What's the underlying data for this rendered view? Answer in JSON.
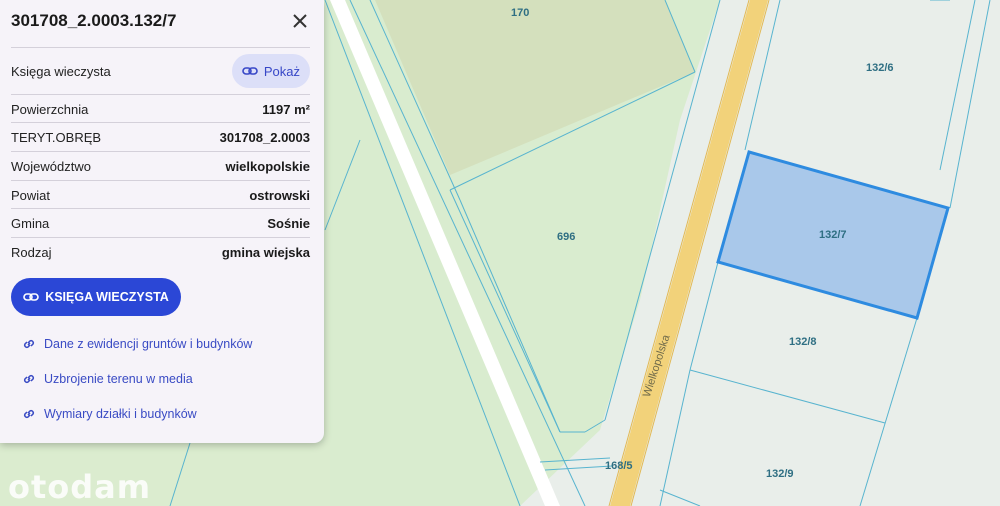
{
  "map": {
    "plots": [
      "170",
      "132/6",
      "696",
      "132/7",
      "132/8",
      "132/9",
      "168/5"
    ],
    "street": "Wielkopolska",
    "selected_plot": "132/7",
    "colors": {
      "background": "#e9eeea",
      "green_area": "#d9eccf",
      "field": "#d4e0bd",
      "road": "#f2d27a",
      "selection": "#a9c8ea",
      "selection_border": "#2e8be0",
      "lines": "#58b4cf"
    }
  },
  "watermark": "otodam",
  "panel": {
    "title": "301708_2.0003.132/7",
    "close_icon": "close-icon",
    "rows": [
      {
        "label": "Księga wieczysta",
        "button": "Pokaż"
      },
      {
        "label": "Powierzchnia",
        "value": "1197 m²"
      },
      {
        "label": "TERYT.OBRĘB",
        "value": "301708_2.0003"
      },
      {
        "label": "Województwo",
        "value": "wielkopolskie"
      },
      {
        "label": "Powiat",
        "value": "ostrowski"
      },
      {
        "label": "Gmina",
        "value": "Sośnie"
      },
      {
        "label": "Rodzaj",
        "value": "gmina wiejska"
      }
    ],
    "primary_button": "KSIĘGA WIECZYSTA",
    "links": [
      "Dane z ewidencji gruntów i budynków",
      "Uzbrojenie terenu w media",
      "Wymiary działki i budynków"
    ]
  }
}
